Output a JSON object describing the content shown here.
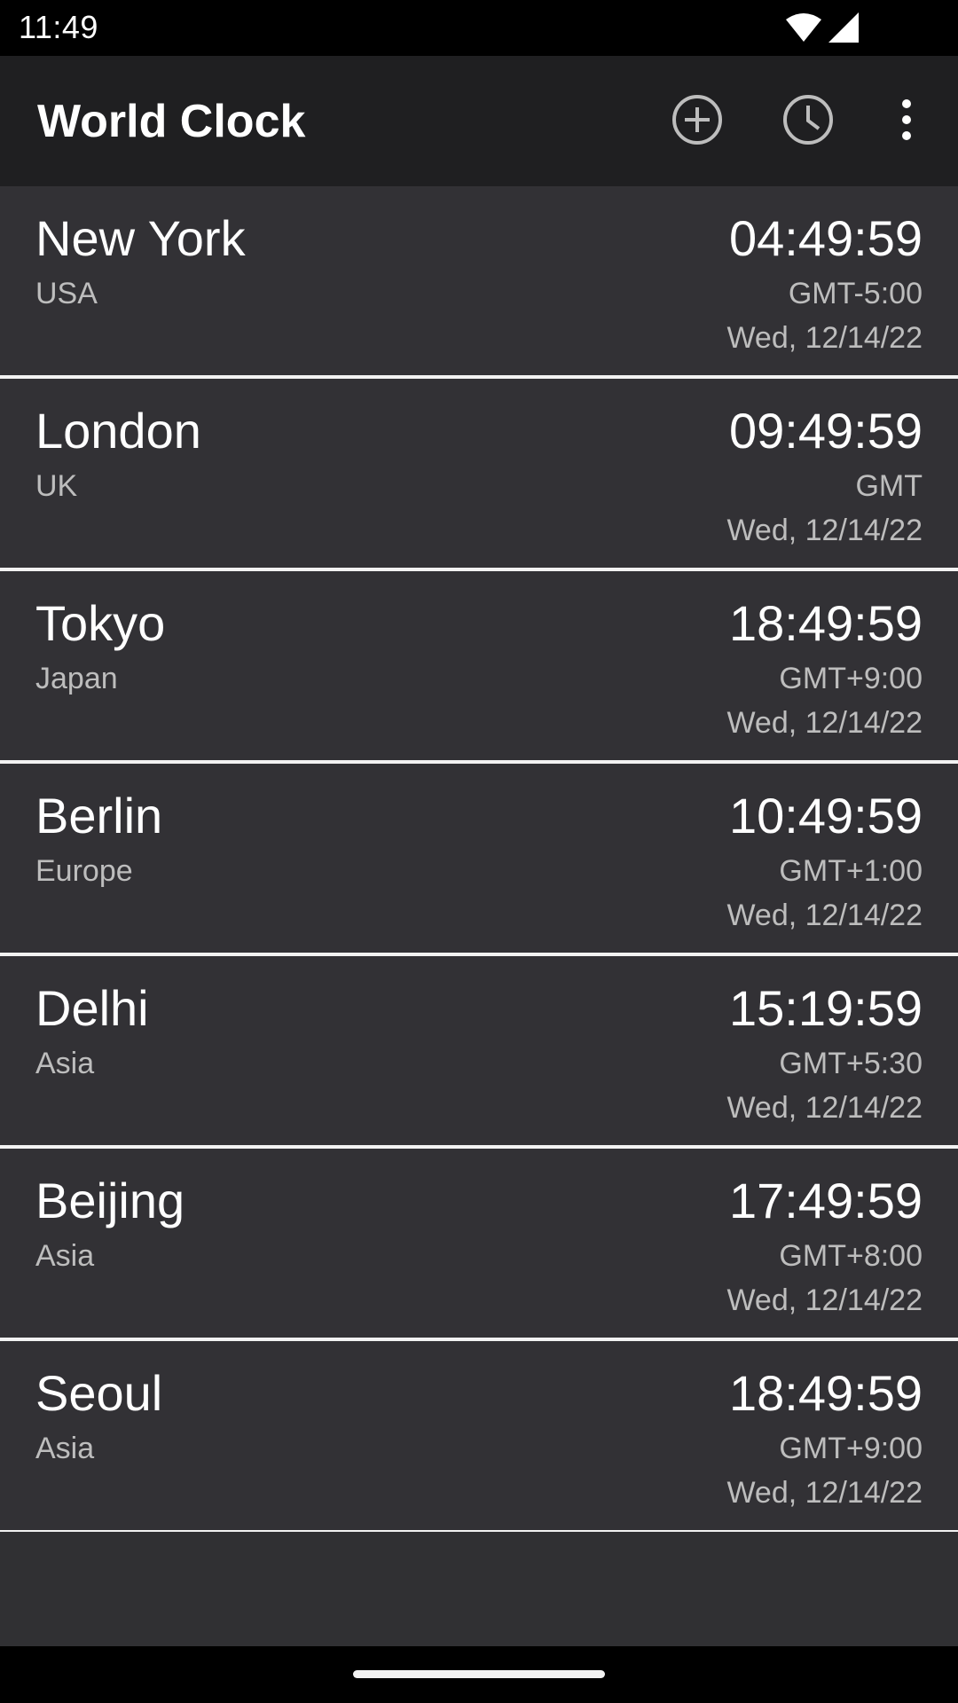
{
  "status_bar": {
    "time": "11:49",
    "icons": [
      "wifi-icon",
      "cellular-signal-icon"
    ]
  },
  "app_bar": {
    "title": "World Clock",
    "actions": [
      "add-circle-icon",
      "clock-icon",
      "more-vert-icon"
    ]
  },
  "clocks": [
    {
      "city": "New York",
      "region": "USA",
      "time": "04:49:59",
      "offset": "GMT-5:00",
      "date": "Wed, 12/14/22"
    },
    {
      "city": "London",
      "region": "UK",
      "time": "09:49:59",
      "offset": "GMT",
      "date": "Wed, 12/14/22"
    },
    {
      "city": "Tokyo",
      "region": "Japan",
      "time": "18:49:59",
      "offset": "GMT+9:00",
      "date": "Wed, 12/14/22"
    },
    {
      "city": "Berlin",
      "region": "Europe",
      "time": "10:49:59",
      "offset": "GMT+1:00",
      "date": "Wed, 12/14/22"
    },
    {
      "city": "Delhi",
      "region": "Asia",
      "time": "15:19:59",
      "offset": "GMT+5:30",
      "date": "Wed, 12/14/22"
    },
    {
      "city": "Beijing",
      "region": "Asia",
      "time": "17:49:59",
      "offset": "GMT+8:00",
      "date": "Wed, 12/14/22"
    },
    {
      "city": "Seoul",
      "region": "Asia",
      "time": "18:49:59",
      "offset": "GMT+9:00",
      "date": "Wed, 12/14/22"
    }
  ],
  "colors": {
    "background": "#303033",
    "row_background": "#323135",
    "app_bar": "#1f1f21",
    "divider": "#f2f2f2",
    "primary_text": "#ffffff",
    "secondary_text": "#bdbdbd"
  }
}
